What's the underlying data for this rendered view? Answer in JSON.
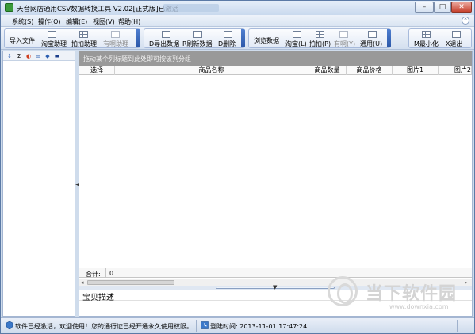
{
  "window": {
    "title": "天音网店通用CSV数据转换工具 V2.02[正式版]已激活",
    "controls": {
      "minimize": "–",
      "maximize": "□",
      "close": "✕"
    }
  },
  "menu": {
    "items": [
      "系统(S)",
      "操作(O)",
      "编辑(E)",
      "视图(V)",
      "帮助(H)"
    ],
    "collapse": "⌃"
  },
  "toolbar": {
    "import": "导入文件",
    "taobao_assistant": "淘宝助理",
    "paipai_assistant": "拍拍助理",
    "youa_assistant": "有啊助理",
    "export": "D导出数据",
    "refresh": "R刷新数据",
    "delete": "D删除",
    "browse": "浏览数据",
    "browse_taobao": "淘宝(L)",
    "browse_paipai": "拍拍(P)",
    "browse_youa": "有啊(Y)",
    "browse_general": "通用(U)",
    "minimize": "M最小化",
    "exit": "X退出"
  },
  "left_panel": {
    "tools": [
      "⇕",
      "Σ",
      "◐",
      "≡",
      "◆",
      "▬"
    ]
  },
  "grid": {
    "group_hint": "拖动某个列标题到此处即可按该列分组",
    "columns": [
      "选择",
      "商品名称",
      "商品数量",
      "商品价格",
      "图片1",
      "图片2"
    ],
    "total_label": "合计:",
    "total_value": "0"
  },
  "description": {
    "title": "宝贝描述"
  },
  "watermark": {
    "text": "当下软件园",
    "url": "www.downxia.com"
  },
  "status": {
    "message": "软件已经激活，欢迎使用！您的通行证已经开通永久使用权限。",
    "login_time": "登陆时间: 2013-11-01 17:47:24"
  }
}
